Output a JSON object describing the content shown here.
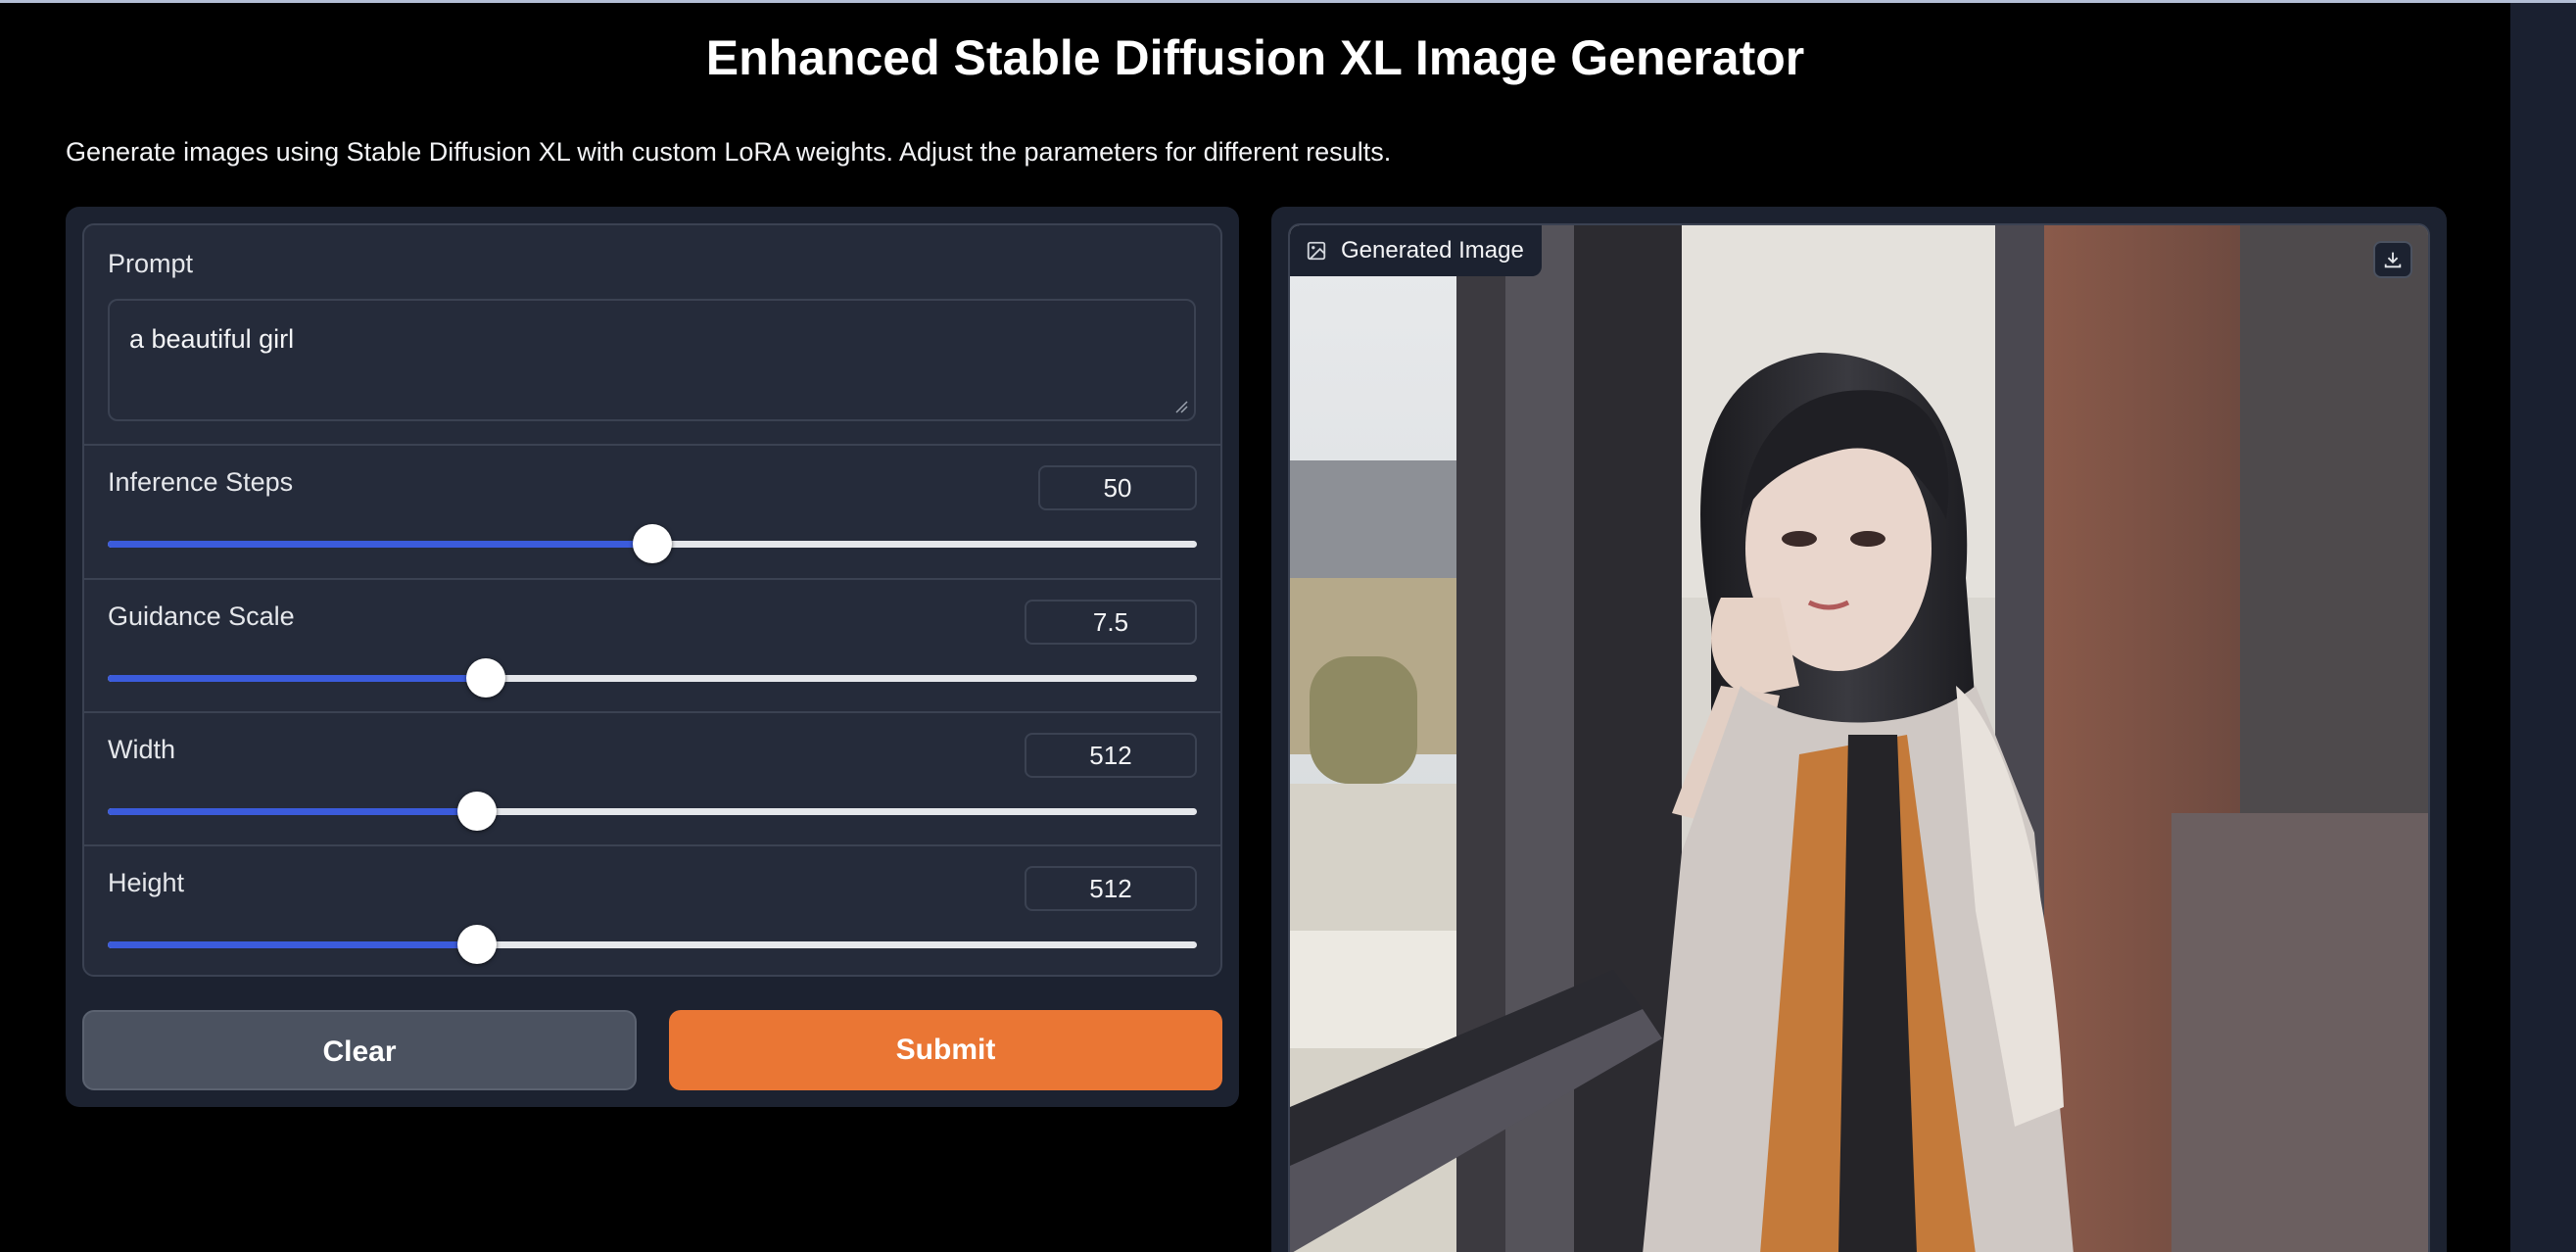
{
  "header": {
    "title": "Enhanced Stable Diffusion XL Image Generator",
    "description": "Generate images using Stable Diffusion XL with custom LoRA weights. Adjust the parameters for different results."
  },
  "form": {
    "prompt": {
      "label": "Prompt",
      "value": "a beautiful girl"
    },
    "inference_steps": {
      "label": "Inference Steps",
      "value": "50",
      "fraction": 0.5
    },
    "guidance_scale": {
      "label": "Guidance Scale",
      "value": "7.5",
      "fraction": 0.347
    },
    "width": {
      "label": "Width",
      "value": "512",
      "fraction": 0.339
    },
    "height": {
      "label": "Height",
      "value": "512",
      "fraction": 0.339
    }
  },
  "buttons": {
    "clear": "Clear",
    "submit": "Submit"
  },
  "output": {
    "label": "Generated Image",
    "label_icon": "image-icon",
    "download_icon": "download-icon"
  },
  "colors": {
    "accent": "#ea7634",
    "slider_fill": "#3b5bdb",
    "panel": "#1c2230",
    "background": "#000000"
  }
}
